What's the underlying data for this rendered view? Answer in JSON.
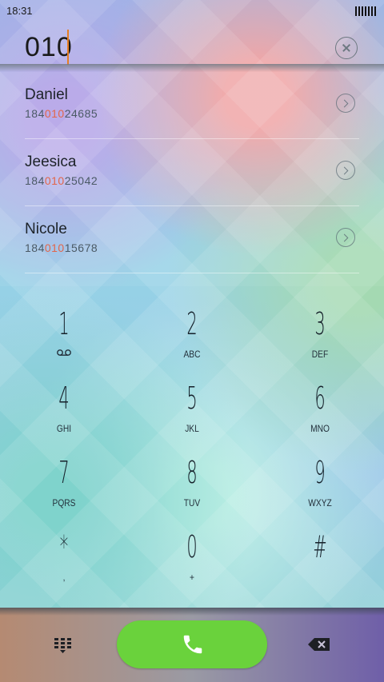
{
  "status_bar": {
    "time": "18:31"
  },
  "dialer": {
    "input": "010"
  },
  "contacts": [
    {
      "name": "Daniel",
      "number_pre": "184",
      "number_match": "010",
      "number_post": "24685"
    },
    {
      "name": "Jeesica",
      "number_pre": "184",
      "number_match": "010",
      "number_post": "25042"
    },
    {
      "name": "Nicole",
      "number_pre": "184",
      "number_match": "010",
      "number_post": "15678"
    }
  ],
  "keypad": [
    {
      "digit": "1",
      "letters": ""
    },
    {
      "digit": "2",
      "letters": "ABC"
    },
    {
      "digit": "3",
      "letters": "DEF"
    },
    {
      "digit": "4",
      "letters": "GHI"
    },
    {
      "digit": "5",
      "letters": "JKL"
    },
    {
      "digit": "6",
      "letters": "MNO"
    },
    {
      "digit": "7",
      "letters": "PQRS"
    },
    {
      "digit": "8",
      "letters": "TUV"
    },
    {
      "digit": "9",
      "letters": "WXYZ"
    },
    {
      "digit": "*",
      "letters": ","
    },
    {
      "digit": "0",
      "letters": "+"
    },
    {
      "digit": "#",
      "letters": ""
    }
  ],
  "icons": {
    "clear": "close-circle-icon",
    "contact_arrow": "chevron-right-circle-icon",
    "voicemail": "voicemail-icon",
    "keypad_toggle": "dialpad-icon",
    "call": "phone-icon",
    "backspace": "backspace-icon"
  },
  "colors": {
    "call_button": "#6ad23c",
    "match_highlight": "#e2664b",
    "caret": "#e67e22"
  }
}
